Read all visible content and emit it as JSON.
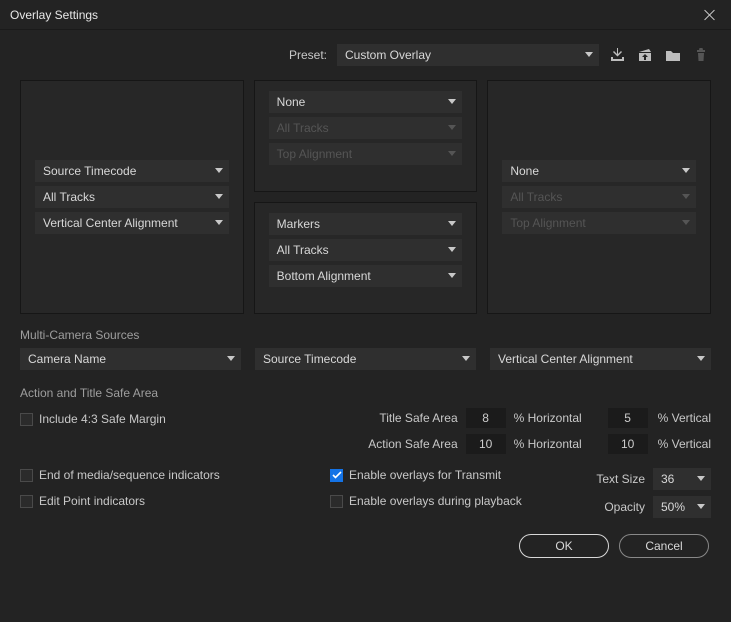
{
  "window": {
    "title": "Overlay Settings"
  },
  "preset": {
    "label": "Preset:",
    "value": "Custom Overlay"
  },
  "overlay_grid": {
    "top_center": {
      "source": "None",
      "tracks": "All Tracks",
      "align": "Top Alignment"
    },
    "middle_left": {
      "source": "Source Timecode",
      "tracks": "All Tracks",
      "align": "Vertical Center Alignment"
    },
    "middle_right": {
      "source": "None",
      "tracks": "All Tracks",
      "align": "Top Alignment"
    },
    "bottom_center": {
      "source": "Markers",
      "tracks": "All Tracks",
      "align": "Bottom Alignment"
    }
  },
  "multi_camera": {
    "label": "Multi-Camera Sources",
    "name": "Camera Name",
    "metadata": "Source Timecode",
    "align": "Vertical Center Alignment"
  },
  "safe_area": {
    "label": "Action and Title Safe Area",
    "include_43_label": "Include 4:3 Safe Margin",
    "include_43_checked": false,
    "title_safe_label": "Title Safe Area",
    "action_safe_label": "Action Safe Area",
    "horiz_label": "% Horizontal",
    "vert_label": "% Vertical",
    "title_h": "8",
    "title_v": "5",
    "action_h": "10",
    "action_v": "10"
  },
  "options": {
    "end_media_label": "End of media/sequence indicators",
    "end_media_checked": false,
    "edit_point_label": "Edit Point indicators",
    "edit_point_checked": false,
    "enable_transmit_label": "Enable overlays for Transmit",
    "enable_transmit_checked": true,
    "enable_playback_label": "Enable overlays during playback",
    "enable_playback_checked": false,
    "text_size_label": "Text Size",
    "text_size_value": "36",
    "opacity_label": "Opacity",
    "opacity_value": "50%"
  },
  "buttons": {
    "ok": "OK",
    "cancel": "Cancel"
  }
}
